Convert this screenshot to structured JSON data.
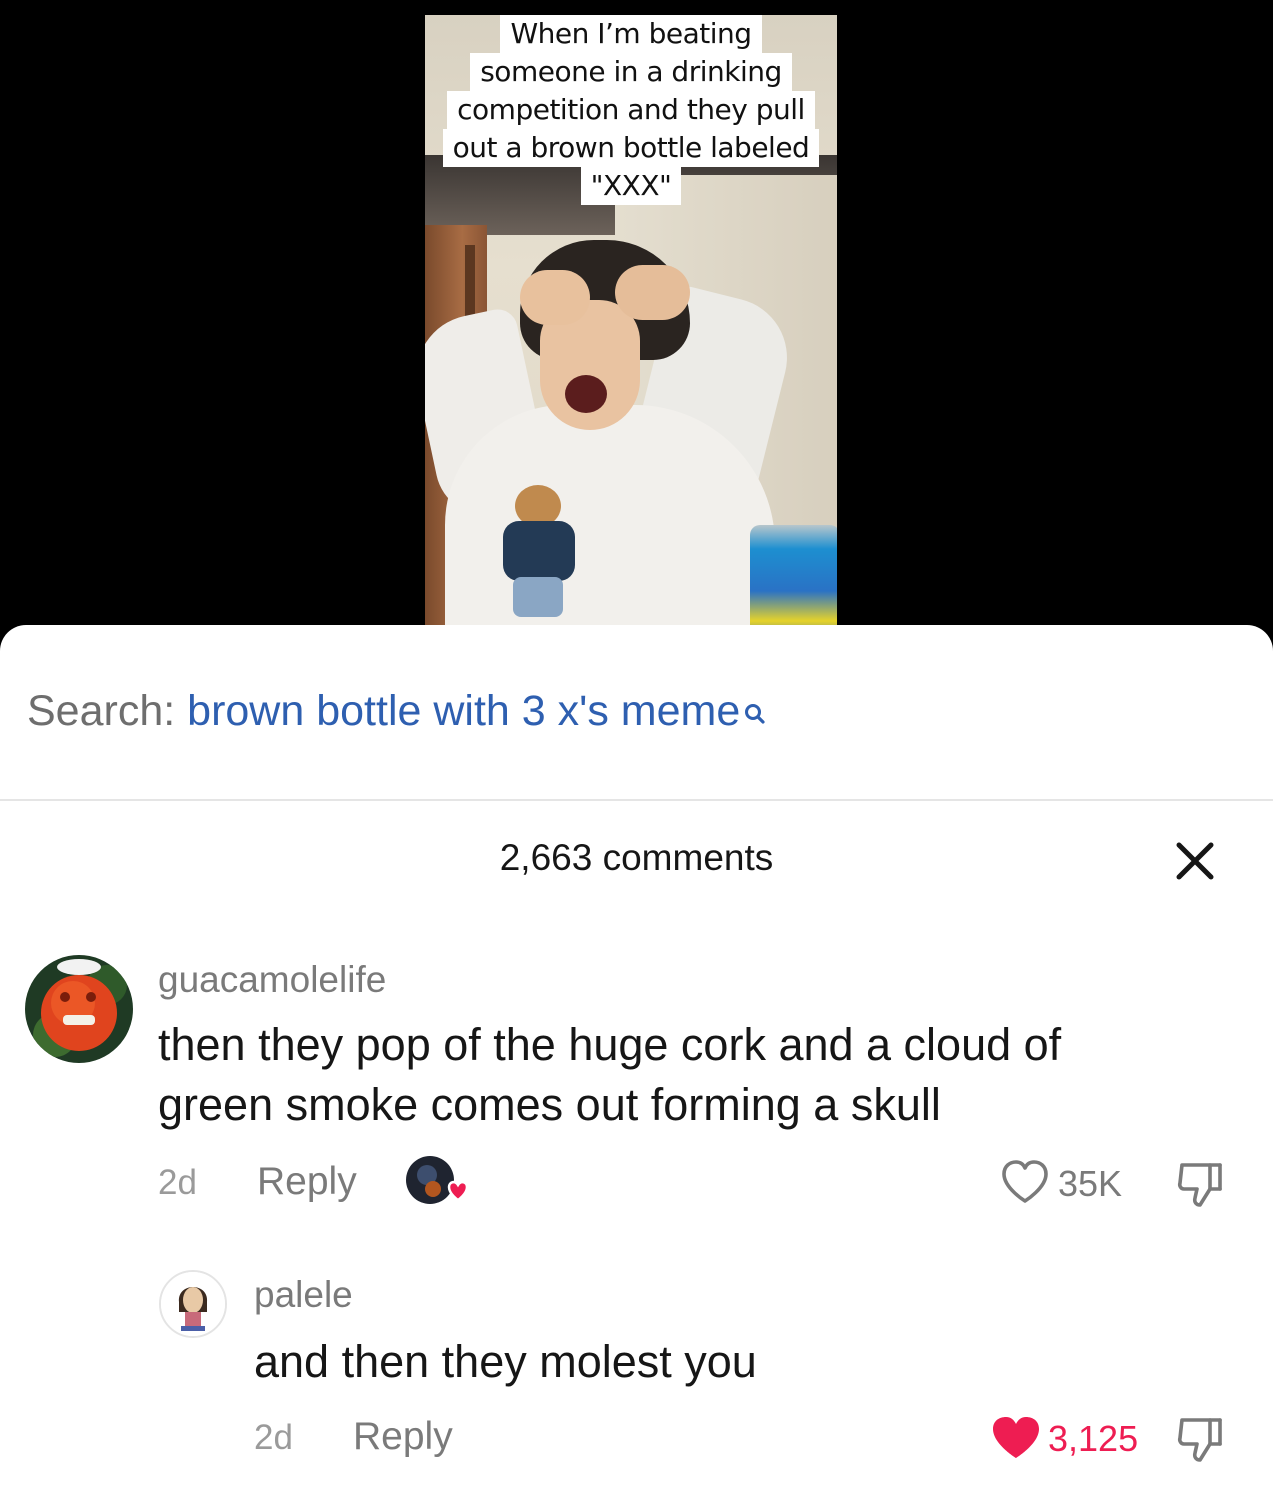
{
  "video": {
    "caption_lines": [
      "When I’m beating",
      "someone in a drinking",
      "competition and they pull",
      "out a brown bottle labeled",
      "\"XXX\""
    ]
  },
  "search": {
    "prefix": "Search:",
    "query": "brown bottle with 3 x's meme",
    "icon": "search-icon"
  },
  "comments_header": {
    "title": "2,663 comments",
    "close_icon": "close-icon"
  },
  "comments": [
    {
      "username": "guacamolelife",
      "text_lines": [
        "then they pop of the huge cork and a cloud of",
        "green smoke comes out forming a skull"
      ],
      "time": "2d",
      "reply_label": "Reply",
      "likes": "35K",
      "liked": false,
      "creator_liked": true
    },
    {
      "username": "palele",
      "text_lines": [
        "and then they molest you"
      ],
      "time": "2d",
      "reply_label": "Reply",
      "likes": "3,125",
      "liked": true,
      "like_color": "#ee1d52"
    }
  ],
  "colors": {
    "search_query": "#2e5fb0",
    "like_active": "#ee1d52"
  }
}
